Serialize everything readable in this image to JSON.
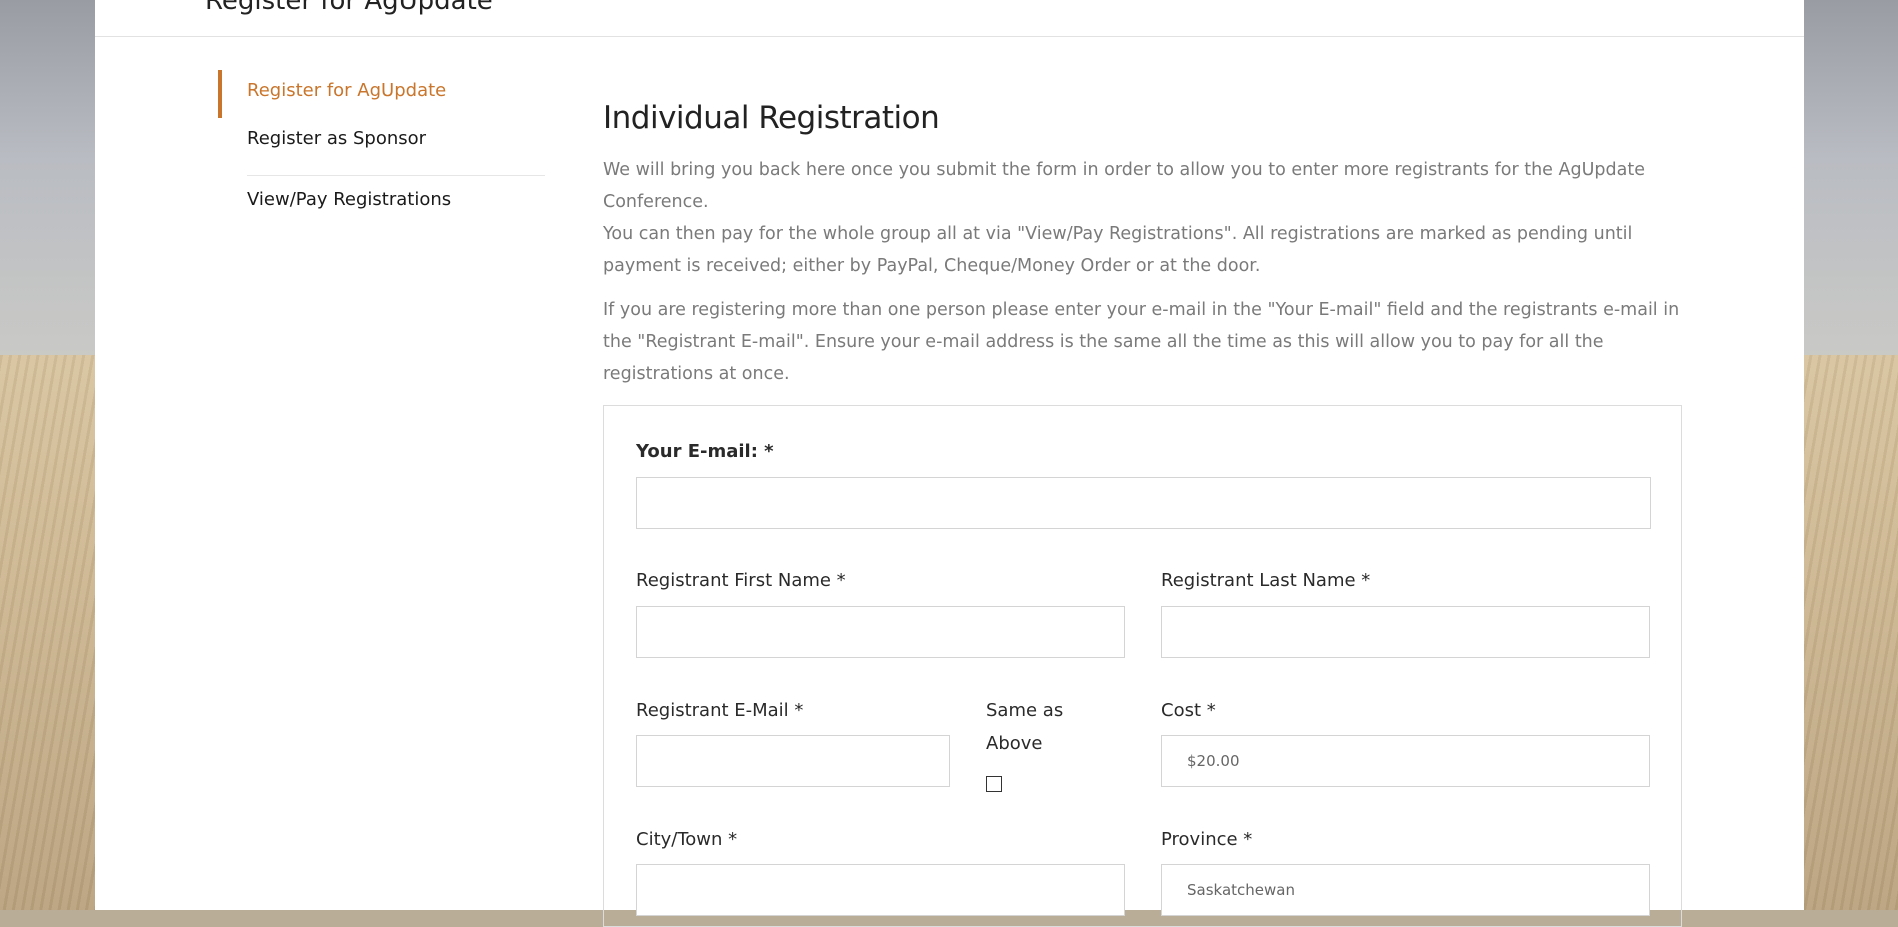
{
  "page": {
    "top_title": "Register for AgUpdate"
  },
  "sidebar": {
    "items": [
      {
        "label": "Register for AgUpdate",
        "active": true
      },
      {
        "label": "Register as Sponsor",
        "active": false
      },
      {
        "label": "View/Pay Registrations",
        "active": false
      }
    ]
  },
  "main": {
    "heading": "Individual Registration",
    "intro_1": "We will bring you back here once you submit the form in order to allow you to enter more registrants for the AgUpdate Conference.",
    "intro_2": "You can then pay for the whole group all at via \"View/Pay Registrations\". All registrations are marked as pending until payment is received; either by PayPal, Cheque/Money Order or at the door.",
    "intro_3": "If you are registering more than one person please enter your e-mail in the \"Your E-mail\" field and the registrants e-mail in the \"Registrant E-mail\". Ensure your e-mail address is the same all the time as this will allow you to pay for all the registrations at once."
  },
  "form": {
    "your_email": {
      "label": "Your E-mail: *",
      "value": ""
    },
    "first_name": {
      "label": "Registrant First Name *",
      "value": ""
    },
    "last_name": {
      "label": "Registrant Last Name *",
      "value": ""
    },
    "reg_email": {
      "label": "Registrant E-Mail *",
      "value": ""
    },
    "same_as_above": {
      "label_line1": "Same as",
      "label_line2": "Above",
      "checked": false
    },
    "cost": {
      "label": "Cost *",
      "value": "$20.00"
    },
    "city": {
      "label": "City/Town *",
      "value": ""
    },
    "province": {
      "label": "Province *",
      "value": "Saskatchewan"
    }
  },
  "colors": {
    "accent": "#c9752b",
    "text": "#222222",
    "muted": "#7a7a7a",
    "border": "#d4d4d4"
  }
}
